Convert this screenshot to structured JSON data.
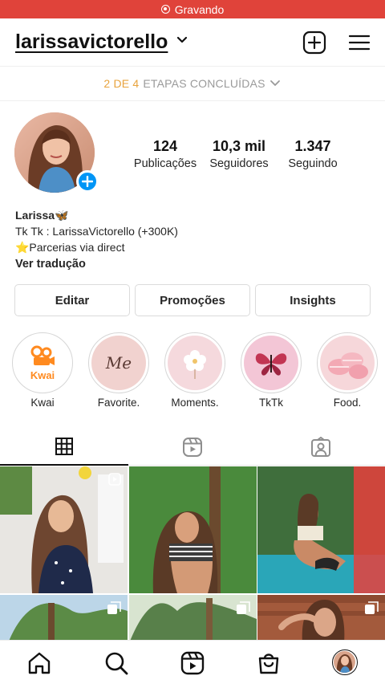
{
  "recording": {
    "label": "Gravando"
  },
  "header": {
    "username": "larissavictorello"
  },
  "steps": {
    "count": "2 DE 4",
    "label": "ETAPAS CONCLUÍDAS"
  },
  "stats": [
    {
      "value": "124",
      "label": "Publicações"
    },
    {
      "value": "10,3 mil",
      "label": "Seguidores"
    },
    {
      "value": "1.347",
      "label": "Seguindo"
    }
  ],
  "bio": {
    "name": "Larissa🦋",
    "line1": "Tk Tk : LarissaVictorello (+300K)",
    "line2": "⭐Parcerias via direct",
    "translate": "Ver tradução"
  },
  "buttons": {
    "edit": "Editar",
    "promotions": "Promoções",
    "insights": "Insights"
  },
  "highlights": [
    {
      "label": "Kwai",
      "badge_text": "Kwai"
    },
    {
      "label": "Favorite.",
      "badge_text": "Me"
    },
    {
      "label": "Moments."
    },
    {
      "label": "TkTk"
    },
    {
      "label": "Food."
    }
  ],
  "colors": {
    "recording_bar": "#e0433a",
    "accent_blue": "#0095f6",
    "steps_count": "#e8a33d",
    "kwai_orange": "#ff8a1f"
  },
  "icons": {
    "header": [
      "add-post-icon",
      "menu-icon"
    ],
    "tabs": [
      "grid-icon",
      "reels-icon",
      "tagged-icon"
    ],
    "nav": [
      "home-icon",
      "search-icon",
      "reels-icon",
      "shop-icon",
      "profile-avatar"
    ]
  }
}
